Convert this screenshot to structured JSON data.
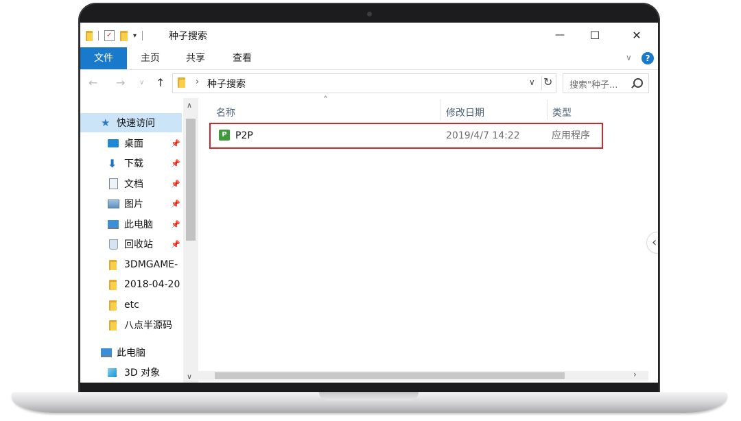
{
  "window": {
    "title": "种子搜索",
    "controls": {
      "minimize": "—",
      "maximize": "☐",
      "close": "✕"
    }
  },
  "ribbon": {
    "tabs": [
      {
        "label": "文件",
        "active": true
      },
      {
        "label": "主页"
      },
      {
        "label": "共享"
      },
      {
        "label": "查看"
      }
    ],
    "help_icon": "?"
  },
  "address": {
    "path": "种子搜索",
    "search_placeholder": "搜索\"种子..."
  },
  "nav_pane": {
    "items": [
      {
        "label": "快速访问",
        "icon": "star-icon",
        "selected": true
      },
      {
        "label": "桌面",
        "icon": "desktop-icon",
        "pinned": true
      },
      {
        "label": "下载",
        "icon": "download-icon",
        "pinned": true
      },
      {
        "label": "文档",
        "icon": "document-icon",
        "pinned": true
      },
      {
        "label": "图片",
        "icon": "pictures-icon",
        "pinned": true
      },
      {
        "label": "此电脑",
        "icon": "computer-icon",
        "pinned": true
      },
      {
        "label": "回收站",
        "icon": "recycle-bin-icon",
        "pinned": true
      },
      {
        "label": "3DMGAME-",
        "icon": "folder-icon"
      },
      {
        "label": "2018-04-20",
        "icon": "folder-icon"
      },
      {
        "label": "etc",
        "icon": "folder-icon"
      },
      {
        "label": "八点半源码",
        "icon": "folder-icon"
      },
      {
        "label": "此电脑",
        "icon": "computer-icon"
      },
      {
        "label": "3D 对象",
        "icon": "3d-objects-icon"
      }
    ]
  },
  "file_list": {
    "columns": [
      "名称",
      "修改日期",
      "类型"
    ],
    "rows": [
      {
        "name": "P2P",
        "modified": "2019/4/7 14:22",
        "type": "应用程序",
        "highlighted": true
      }
    ]
  },
  "colors": {
    "accent": "#1979ca",
    "highlight_border": "#d0262c",
    "selected_bg": "#cce4f7"
  }
}
